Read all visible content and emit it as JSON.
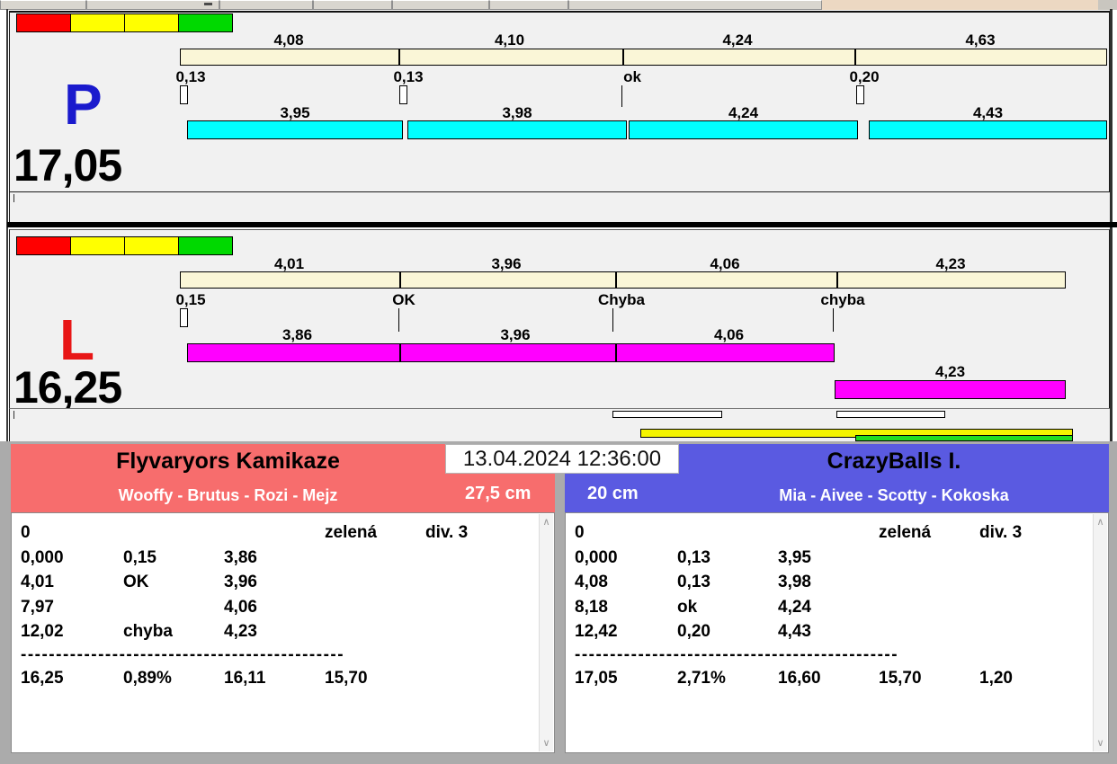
{
  "race": {
    "timestamp": "13.04.2024 12:36:00"
  },
  "lanes": {
    "p": {
      "label": "P",
      "total": "17,05",
      "splits": [
        "4,08",
        "4,10",
        "4,24",
        "4,63"
      ],
      "marks": [
        "0,13",
        "0,13",
        "ok",
        "0,20"
      ],
      "dog_times": [
        "3,95",
        "3,98",
        "4,24",
        "4,43"
      ]
    },
    "l": {
      "label": "L",
      "total": "16,25",
      "splits": [
        "4,01",
        "3,96",
        "4,06",
        "4,23"
      ],
      "marks": [
        "0,15",
        "OK",
        "Chyba",
        "chyba"
      ],
      "dog_times": [
        "3,86",
        "3,96",
        "4,06",
        "4,23"
      ]
    }
  },
  "teams": {
    "left": {
      "name": "Flyvaryors Kamikaze",
      "dogs": "Wooffy - Brutus - Rozi - Mejz",
      "jump_height": "27,5 cm",
      "table": {
        "r0": [
          "0",
          "zelená",
          "div. 3"
        ],
        "r1": [
          "0,000",
          "0,15",
          "3,86"
        ],
        "r2": [
          "4,01",
          "OK",
          "3,96"
        ],
        "r3": [
          "7,97",
          "",
          "4,06"
        ],
        "r4": [
          "12,02",
          "chyba",
          "4,23"
        ],
        "sep": "----------------------------------------------",
        "sum": [
          "16,25",
          "0,89%",
          "16,11",
          "15,70",
          ""
        ]
      }
    },
    "right": {
      "name": "CrazyBalls I.",
      "dogs": "Mia - Aivee - Scotty - Kokoska",
      "jump_height": "20 cm",
      "table": {
        "r0": [
          "0",
          "zelená",
          "div. 3"
        ],
        "r1": [
          "0,000",
          "0,13",
          "3,95"
        ],
        "r2": [
          "4,08",
          "0,13",
          "3,98"
        ],
        "r3": [
          "8,18",
          "ok",
          "4,24"
        ],
        "r4": [
          "12,42",
          "0,20",
          "4,43"
        ],
        "sep": "----------------------------------------------",
        "sum": [
          "17,05",
          "2,71%",
          "16,60",
          "15,70",
          "1,20"
        ]
      }
    }
  },
  "icons": {
    "scroll_up": "∧",
    "scroll_down": "∨"
  },
  "colors": {
    "accent-red": "#f76d6d",
    "accent-blue": "#5a5ae1",
    "bar-cream": "#faf6d7",
    "bar-cyan": "#00ffff",
    "bar-magenta": "#ff00ff",
    "bar-yellow": "#f4f400",
    "bar-green": "#22dc22",
    "light-red": "#ff0000",
    "light-yellow": "#ffff00",
    "light-green": "#00d900",
    "lane-p-color": "#1a1acd",
    "lane-l-color": "#e81616",
    "panel-gray": "#f1f1f1",
    "band-gray": "#ababab",
    "top-tan": "#ecd8c2"
  }
}
